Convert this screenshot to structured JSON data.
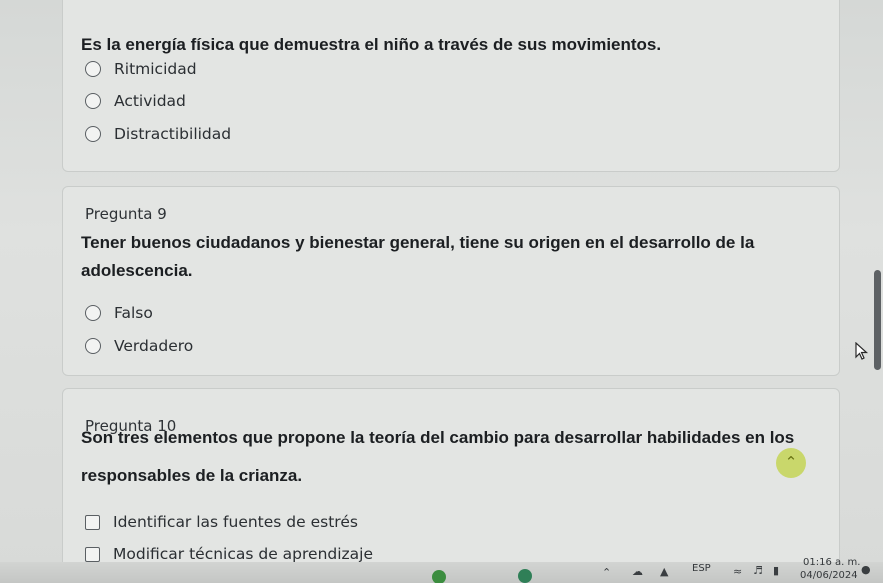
{
  "question_8": {
    "text": "Es la energía física que demuestra el niño a través de sus movimientos.",
    "options": [
      "Ritmicidad",
      "Actividad",
      "Distractibilidad"
    ]
  },
  "question_9": {
    "number": "Pregunta 9",
    "text_line1": "Tener buenos ciudadanos y bienestar general, tiene su origen en el desarrollo de la",
    "text_line2": "adolescencia.",
    "options": [
      "Falso",
      "Verdadero"
    ]
  },
  "question_10": {
    "number": "Pregunta 10",
    "text_line1": "Son tres elementos que propone la teoría del cambio para desarrollar habilidades en los",
    "text_line2": "responsables de la crianza.",
    "options": [
      "Identificar las fuentes de estrés",
      "Modificar técnicas de aprendizaje"
    ]
  },
  "taskbar": {
    "language": "ESP",
    "time": "01:16 a. m.",
    "date": "04/06/2024"
  },
  "icons": {
    "scroll_top": "double-chevron-up-icon",
    "mouse_cursor": "arrow-cursor-icon",
    "wifi": "wifi-icon",
    "volume": "volume-icon",
    "battery": "battery-icon",
    "notifications": "bell-icon",
    "tray_expand": "chevron-up-icon"
  },
  "colors": {
    "scroll_top_button": "#c9d76b",
    "page_background": "#d9dbd9"
  }
}
